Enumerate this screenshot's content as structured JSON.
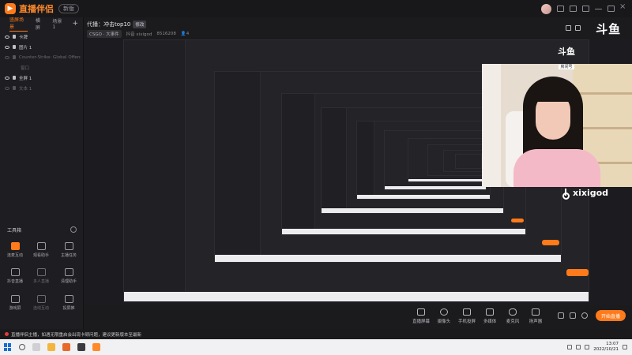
{
  "app": {
    "name": "直播伴侣",
    "version_badge": "新版"
  },
  "left_panel": {
    "tabs": [
      {
        "label": "竖屏场景"
      },
      {
        "label": "横屏"
      },
      {
        "label": "场景1"
      }
    ],
    "add_label": "+",
    "sources": [
      {
        "label": "卡牌"
      },
      {
        "label": "图片 1"
      },
      {
        "label": "Counter-Strike: Global Offensive"
      },
      {
        "label": "窗口"
      },
      {
        "label": "全屏 1"
      },
      {
        "label": "文本 1"
      }
    ],
    "tools_title": "工具箱",
    "tools": [
      {
        "label": "连麦互动",
        "color": "#ff7a1a"
      },
      {
        "label": "观看助手",
        "color": "#9a9aa0"
      },
      {
        "label": "主播任务",
        "color": "#9a9aa0"
      },
      {
        "label": "抖音直播",
        "color": "#9a9aa0"
      },
      {
        "label": "多人直播",
        "color": "#6b6b70"
      },
      {
        "label": "清理助手",
        "color": "#9a9aa0"
      },
      {
        "label": "游戏屏",
        "color": "#9a9aa0"
      },
      {
        "label": "连线互动",
        "color": "#6b6b70"
      },
      {
        "label": "投屏推",
        "color": "#9a9aa0"
      }
    ]
  },
  "header": {
    "room_prefix": "代播：",
    "room_title": "冲击top10",
    "edit_label": "修改",
    "meta": {
      "category": "CSGO · 大事件",
      "account": "抖音 xixigod",
      "id": "8516208",
      "viewers": "4"
    }
  },
  "douyu": {
    "brand": "斗鱼",
    "tag": "房间号",
    "room": "8516208"
  },
  "watermark": {
    "name": "xixigod"
  },
  "controls": {
    "items": [
      {
        "label": "直播屏幕"
      },
      {
        "label": "摄像头"
      },
      {
        "label": "手机投屏"
      },
      {
        "label": "多媒体"
      },
      {
        "label": "麦克风"
      },
      {
        "label": "扬声器"
      }
    ],
    "go_live": "开始直播"
  },
  "notice": {
    "text": "直播伴侣主播，如遇无限重启会出现卡顿问题，建议更新版本至最新"
  },
  "taskbar": {
    "time": "13:07",
    "date": "2022/10/21"
  }
}
